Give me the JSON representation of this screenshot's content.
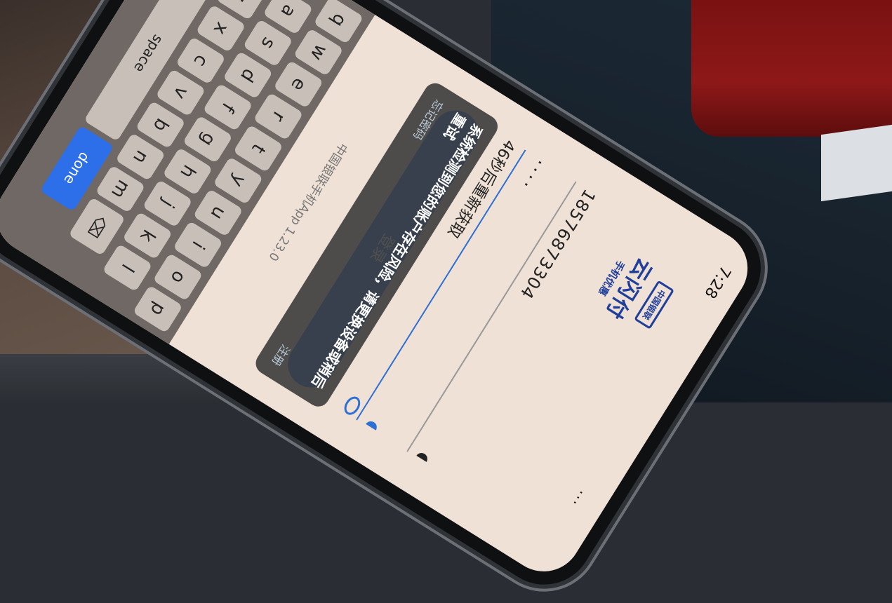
{
  "status": {
    "time": "7:28",
    "signal": "..."
  },
  "logo": {
    "badge": "中国银联",
    "title": "云闪付",
    "subtitle": "手机优惠"
  },
  "form": {
    "phone_number": "18576873304",
    "code_masked": "····",
    "resend_text": "46秒后重新获取",
    "login_label": "登录"
  },
  "toast": {
    "message": "系统检测到您的账户存在风险，请更换设备或稍后重试",
    "link_left": "忘记密码",
    "link_right": "注册"
  },
  "version": "中国银联手机App 1.23.0",
  "keyboard": {
    "row1": [
      "q",
      "w",
      "e",
      "r",
      "t",
      "y",
      "u",
      "i",
      "o",
      "p"
    ],
    "row2": [
      "a",
      "s",
      "d",
      "f",
      "g",
      "h",
      "j",
      "k",
      "l"
    ],
    "row3": [
      "z",
      "x",
      "c",
      "v",
      "b",
      "n",
      "m"
    ],
    "space_label": "space",
    "done_label": "done",
    "backspace_icon": "⌫"
  },
  "colors": {
    "accent": "#3d86e0",
    "logo": "#1f3f9a"
  }
}
